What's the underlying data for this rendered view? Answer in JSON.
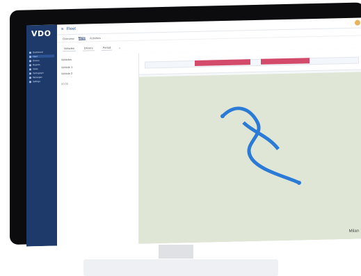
{
  "app": {
    "logo": "VDO",
    "title": "Fleet"
  },
  "sidebar": {
    "items": [
      {
        "label": "Dashboard"
      },
      {
        "label": "Fleet"
      },
      {
        "label": "Drivers"
      },
      {
        "label": "Reports"
      },
      {
        "label": "Tasks"
      },
      {
        "label": "Tachograph"
      },
      {
        "label": "Messages"
      },
      {
        "label": "Settings"
      }
    ]
  },
  "tabs": [
    {
      "label": "Overview"
    },
    {
      "label": "Maps"
    },
    {
      "label": "Activities"
    }
  ],
  "filters": [
    {
      "label": "Vehicles"
    },
    {
      "label": "Drivers"
    },
    {
      "label": "Period"
    }
  ],
  "panel": {
    "title": "Vehicles",
    "rows": [
      {
        "label": "Vehicle 1"
      },
      {
        "label": "Vehicle 2"
      }
    ]
  },
  "status": {
    "time": "00:00"
  },
  "map": {
    "city": "Milan"
  }
}
